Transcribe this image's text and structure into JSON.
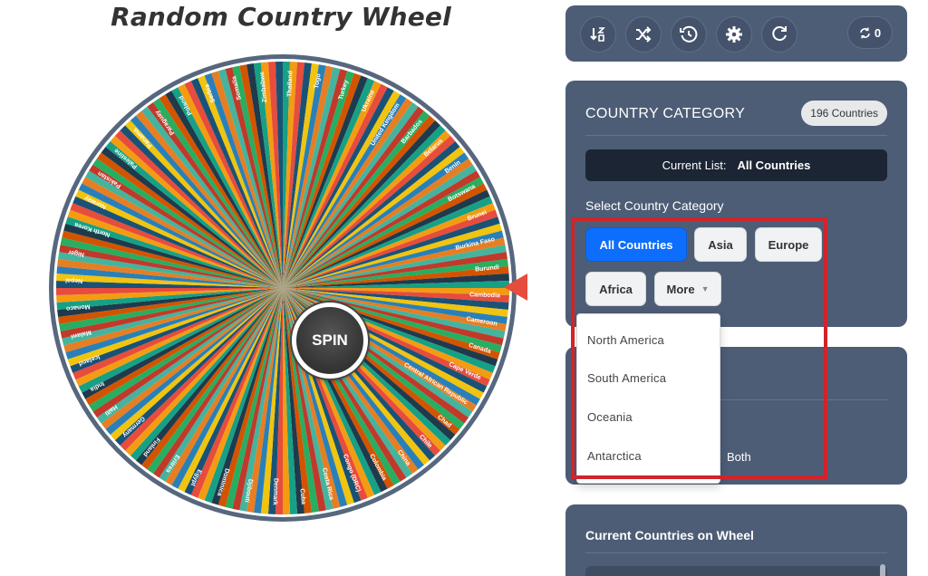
{
  "page": {
    "title": "Random Country Wheel"
  },
  "wheel": {
    "spin_label": "SPIN",
    "colors": [
      "#16a085",
      "#f39c12",
      "#e74c3c",
      "#1a5276",
      "#f1c40f",
      "#2980b9",
      "#e67e22",
      "#45b39d",
      "#c0392b",
      "#27ae60",
      "#d35400",
      "#1f3a4d"
    ],
    "border_color": "#56677e",
    "pointer_color": "#e74c3c",
    "visible_labels": [
      "Thailand",
      "Togo",
      "Turkey",
      "Ukraine",
      "United Kingdom",
      "Barbados",
      "Belarus",
      "Benin",
      "Botswana",
      "Brunei",
      "Burkina Faso",
      "Burundi",
      "Cambodia",
      "Cameroon",
      "Canada",
      "Cape Verde",
      "Central African Republic",
      "Chad",
      "Chile",
      "China",
      "Colombia",
      "Congo (DRC)",
      "Costa Rica",
      "Cuba",
      "Denmark",
      "Djibouti",
      "Dominica",
      "Egypt",
      "Eritrea",
      "Finland",
      "Germany",
      "Haiti",
      "India",
      "Iceland",
      "Malawi",
      "Monaco",
      "Nepal",
      "Niger",
      "North Korea",
      "Norway",
      "Pakistan",
      "Palestine",
      "Panama",
      "Paraguay",
      "Poland",
      "Serbia",
      "Somalia",
      "Zimbabwe"
    ]
  },
  "toolbar": {
    "icons": [
      "sort-icon",
      "shuffle-icon",
      "history-icon",
      "gear-icon",
      "redo-icon"
    ],
    "counter_value": "0"
  },
  "category": {
    "title": "COUNTRY CATEGORY",
    "count_badge": "196 Countries",
    "current_list_label": "Current List:",
    "current_list_value": "All Countries",
    "select_label": "Select Country Category",
    "buttons": [
      "All Countries",
      "Asia",
      "Europe",
      "Africa",
      "More"
    ]
  },
  "dropdown": {
    "items": [
      "North America",
      "South America",
      "Oceania",
      "Antarctica"
    ]
  },
  "settings": {
    "both_label": "Both"
  },
  "current_wheel": {
    "title": "Current Countries on Wheel"
  },
  "colors": {
    "accent": "#0d6efd",
    "panel": "#4d5d76",
    "highlight": "#d0242b"
  }
}
